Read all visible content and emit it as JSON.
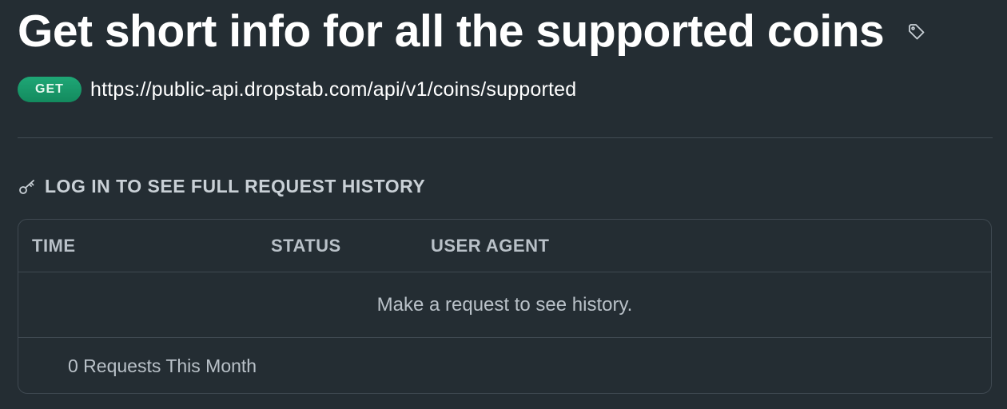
{
  "header": {
    "title": "Get short info for all the supported coins",
    "tag_icon": "tag-icon"
  },
  "endpoint": {
    "method": "GET",
    "url": "https://public-api.dropstab.com/api/v1/coins/supported",
    "method_color": "#1a9c6c"
  },
  "history": {
    "heading": "LOG IN TO SEE FULL REQUEST HISTORY",
    "heading_icon": "key-icon",
    "columns": [
      "TIME",
      "STATUS",
      "USER AGENT"
    ],
    "empty_message": "Make a request to see history.",
    "footer": "0 Requests This Month"
  },
  "colors": {
    "background": "#242d33",
    "border": "#3f4951",
    "muted_text": "#b9c1c8"
  }
}
